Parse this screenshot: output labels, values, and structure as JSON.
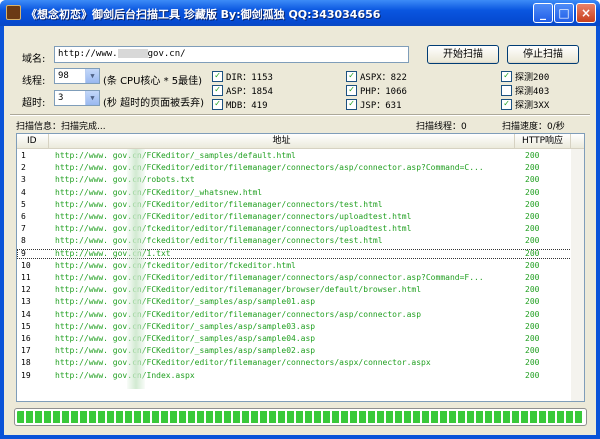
{
  "window": {
    "title": "《想念初恋》御剑后台扫描工具 珍藏版 By:御剑孤独 QQ:343034656",
    "min_label": "_",
    "max_label": "□",
    "close_label": "×"
  },
  "form": {
    "domain_label": "域名:",
    "domain_prefix": "http://www.",
    "domain_suffix": "gov.cn/",
    "threads_label": "线程:",
    "threads_value": "98",
    "threads_hint": "(条 CPU核心 * 5最佳)",
    "timeout_label": "超时:",
    "timeout_value": "3",
    "timeout_hint": "(秒 超时的页面被丢弃)",
    "start_button": "开始扫描",
    "stop_button": "停止扫描"
  },
  "dicts": [
    {
      "label": "DIR：1153",
      "checked": true
    },
    {
      "label": "ASP：1854",
      "checked": true
    },
    {
      "label": "MDB：419",
      "checked": true
    },
    {
      "label": "ASPX：822",
      "checked": true
    },
    {
      "label": "PHP：1066",
      "checked": true
    },
    {
      "label": "JSP：631",
      "checked": true
    }
  ],
  "probes": [
    {
      "label": "探测200",
      "checked": true
    },
    {
      "label": "探测403",
      "checked": false
    },
    {
      "label": "探测3XX",
      "checked": true
    }
  ],
  "status": {
    "info": "扫描信息：扫描完成...",
    "threads": "扫描线程：0",
    "speed": "扫描速度：0/秒"
  },
  "table": {
    "headers": [
      "ID",
      "地址",
      "HTTP响应"
    ],
    "rows": [
      {
        "id": "1",
        "url": "http://www.          gov.cn/FCKeditor/_samples/default.html",
        "status": "200"
      },
      {
        "id": "2",
        "url": "http://www.          gov.cn/FCKeditor/editor/filemanager/connectors/asp/connector.asp?Command=C...",
        "status": "200"
      },
      {
        "id": "3",
        "url": "http://www.          gov.cn/robots.txt",
        "status": "200"
      },
      {
        "id": "4",
        "url": "http://www.          gov.cn/FCKeditor/_whatsnew.html",
        "status": "200"
      },
      {
        "id": "5",
        "url": "http://www.          gov.cn/FCKeditor/editor/filemanager/connectors/test.html",
        "status": "200"
      },
      {
        "id": "6",
        "url": "http://www.          gov.cn/FCKeditor/editor/filemanager/connectors/uploadtest.html",
        "status": "200"
      },
      {
        "id": "7",
        "url": "http://www.          gov.cn/fckeditor/editor/filemanager/connectors/uploadtest.html",
        "status": "200"
      },
      {
        "id": "8",
        "url": "http://www.          gov.cn/fckeditor/editor/filemanager/connectors/test.html",
        "status": "200"
      },
      {
        "id": "9",
        "url": "http://www.          gov.cn/1.txt",
        "status": "200"
      },
      {
        "id": "10",
        "url": "http://www.          gov.cn/fckeditor/editor/fckeditor.html",
        "status": "200"
      },
      {
        "id": "11",
        "url": "http://www.          gov.cn/FCKeditor/editor/filemanager/connectors/asp/connector.asp?Command=F...",
        "status": "200"
      },
      {
        "id": "12",
        "url": "http://www.          gov.cn/FCKeditor/editor/filemanager/browser/default/browser.html",
        "status": "200"
      },
      {
        "id": "13",
        "url": "http://www.          gov.cn/FCKeditor/_samples/asp/sample01.asp",
        "status": "200"
      },
      {
        "id": "14",
        "url": "http://www.          gov.cn/FCKeditor/editor/filemanager/connectors/asp/connector.asp",
        "status": "200"
      },
      {
        "id": "15",
        "url": "http://www.          gov.cn/FCKeditor/_samples/asp/sample03.asp",
        "status": "200"
      },
      {
        "id": "16",
        "url": "http://www.          gov.cn/FCKeditor/_samples/asp/sample04.asp",
        "status": "200"
      },
      {
        "id": "17",
        "url": "http://www.          gov.cn/FCKeditor/_samples/asp/sample02.asp",
        "status": "200"
      },
      {
        "id": "18",
        "url": "http://www.          gov.cn/FCKeditor/editor/filemanager/connectors/aspx/connector.aspx",
        "status": "200"
      },
      {
        "id": "19",
        "url": "http://www.          gov.cn/Index.aspx",
        "status": "200"
      }
    ],
    "selected_row": 8
  },
  "progress": {
    "value_percent": 100
  }
}
